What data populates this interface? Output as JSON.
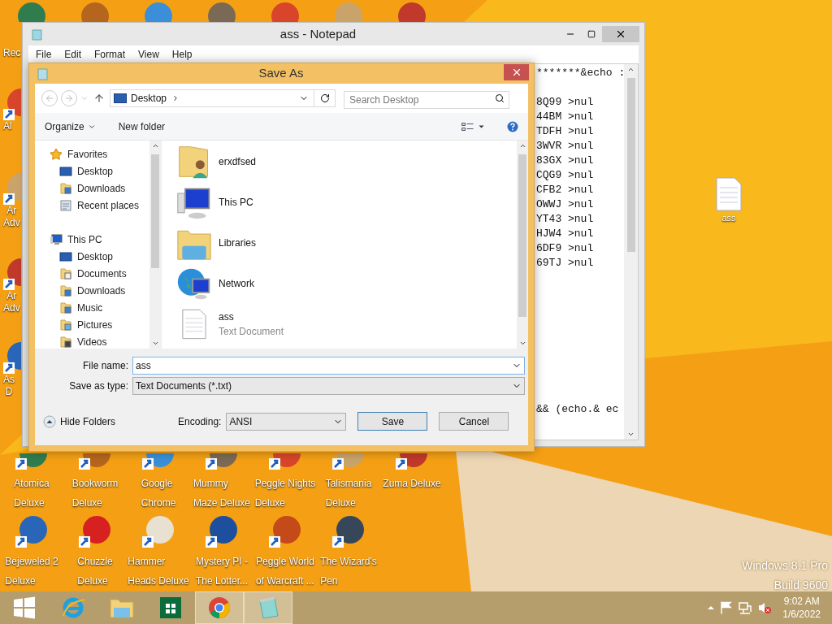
{
  "desktop": {
    "left_icons": [
      {
        "lines": [
          "Rec"
        ]
      },
      {
        "lines": [
          "Al"
        ]
      },
      {
        "lines": [
          "Ar",
          "Adv"
        ]
      },
      {
        "lines": [
          "Ar",
          "Adv"
        ]
      },
      {
        "lines": [
          "As",
          "D"
        ]
      }
    ],
    "bottom_icons": [
      {
        "lines": [
          "Atomica",
          "Deluxe"
        ]
      },
      {
        "lines": [
          "Bookworm",
          "Deluxe"
        ]
      },
      {
        "lines": [
          "Google",
          "Chrome"
        ]
      },
      {
        "lines": [
          "Mummy",
          "Maze Deluxe"
        ]
      },
      {
        "lines": [
          "Peggle Nights",
          "Deluxe"
        ]
      },
      {
        "lines": [
          "Talismania",
          "Deluxe"
        ]
      },
      {
        "lines": [
          "Zuma Deluxe"
        ]
      },
      {
        "lines": [
          "Bejeweled 2",
          "Deluxe"
        ]
      },
      {
        "lines": [
          "Chuzzle",
          "Deluxe"
        ]
      },
      {
        "lines": [
          "Hammer",
          "Heads Deluxe"
        ]
      },
      {
        "lines": [
          "Mystery PI -",
          "The Lotter..."
        ]
      },
      {
        "lines": [
          "Peggle World",
          "of Warcraft ..."
        ]
      },
      {
        "lines": [
          "The Wizard's",
          "Pen"
        ]
      }
    ],
    "file_icon": {
      "label": "ass"
    },
    "watermark": [
      "Windows 8.1 Pro",
      "Build 9600"
    ]
  },
  "notepad": {
    "title": "ass - Notepad",
    "menu": [
      "File",
      "Edit",
      "Format",
      "View",
      "Help"
    ],
    "top_lines": [
      "*******&echo :"
    ],
    "lines": [
      "8Q99 >nul",
      "44BM >nul",
      "TDFH >nul",
      "3WVR >nul",
      "83GX >nul",
      "CQG9 >nul",
      "CFB2 >nul",
      "OWWJ >nul",
      "YT43 >nul",
      "HJW4 >nul",
      "6DF9 >nul",
      "69TJ >nul"
    ],
    "bottom_lines": [
      "&& (echo.& ec"
    ]
  },
  "save_dialog": {
    "title": "Save As",
    "address": "Desktop",
    "search": {
      "placeholder": "Search Desktop"
    },
    "toolbar": [
      "Organize",
      "New folder"
    ],
    "tree": [
      {
        "label": "Favorites",
        "kind": "star",
        "children": [
          {
            "label": "Desktop",
            "kind": "desktop"
          },
          {
            "label": "Downloads",
            "kind": "downloads"
          },
          {
            "label": "Recent places",
            "kind": "recent"
          }
        ]
      },
      {
        "label": "This PC",
        "kind": "computer",
        "children": [
          {
            "label": "Desktop",
            "kind": "desktop"
          },
          {
            "label": "Documents",
            "kind": "documents"
          },
          {
            "label": "Downloads",
            "kind": "downloads"
          },
          {
            "label": "Music",
            "kind": "music"
          },
          {
            "label": "Pictures",
            "kind": "pictures"
          },
          {
            "label": "Videos",
            "kind": "videos"
          }
        ]
      }
    ],
    "files": [
      {
        "name": "erxdfsed",
        "kind": "user-folder"
      },
      {
        "name": "This PC",
        "kind": "computer"
      },
      {
        "name": "Libraries",
        "kind": "libraries"
      },
      {
        "name": "Network",
        "kind": "network"
      },
      {
        "name": "ass",
        "subtitle": "Text Document",
        "kind": "text-file"
      }
    ],
    "file_name": {
      "label": "File name:",
      "value": "ass"
    },
    "save_type": {
      "label": "Save as type:",
      "value": "Text Documents (*.txt)"
    },
    "hide_folders": "Hide Folders",
    "encoding": {
      "label": "Encoding:",
      "value": "ANSI"
    },
    "buttons": [
      "Save",
      "Cancel"
    ]
  },
  "taskbar": {
    "items": [
      {
        "kind": "start",
        "active": false
      },
      {
        "kind": "ie",
        "active": false
      },
      {
        "kind": "explorer",
        "active": false
      },
      {
        "kind": "store",
        "active": false
      },
      {
        "kind": "chrome",
        "active": true
      },
      {
        "kind": "notepad",
        "active": true
      }
    ],
    "time": "9:02 AM",
    "date": "1/6/2022"
  }
}
